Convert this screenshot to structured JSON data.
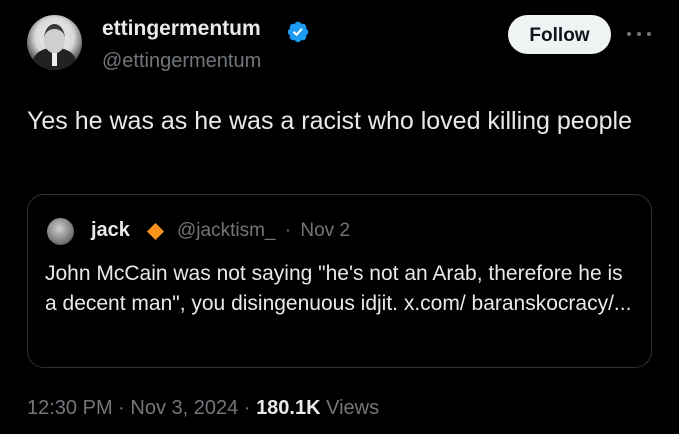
{
  "author": {
    "name": "ettingermentum",
    "handle": "@ettingermentum",
    "verified_icon": "verified-badge-icon",
    "verified_color": "#1d9bf0"
  },
  "follow_label": "Follow",
  "more_icon": "more-horizontal-icon",
  "tweet": {
    "text": "Yes he was as he was a racist who loved killing people"
  },
  "quote": {
    "name": "jack",
    "badge_icon": "orange-diamond-icon",
    "badge_color": "#f7931a",
    "handle": "@jacktism_",
    "separator": "·",
    "date": "Nov 2",
    "text": "John McCain was not saying \"he's not an Arab, therefore he is a decent man\", you disingenuous idjit. x.com/ baranskocracy/..."
  },
  "meta": {
    "time": "12:30 PM",
    "separator": "·",
    "date": "Nov 3, 2024",
    "views_count": "180.1K",
    "views_label": "Views"
  },
  "colors": {
    "background": "#000000",
    "text_primary": "#e7e9ea",
    "text_secondary": "#71767b",
    "border": "#2f3336",
    "follow_bg": "#eff3f4"
  }
}
